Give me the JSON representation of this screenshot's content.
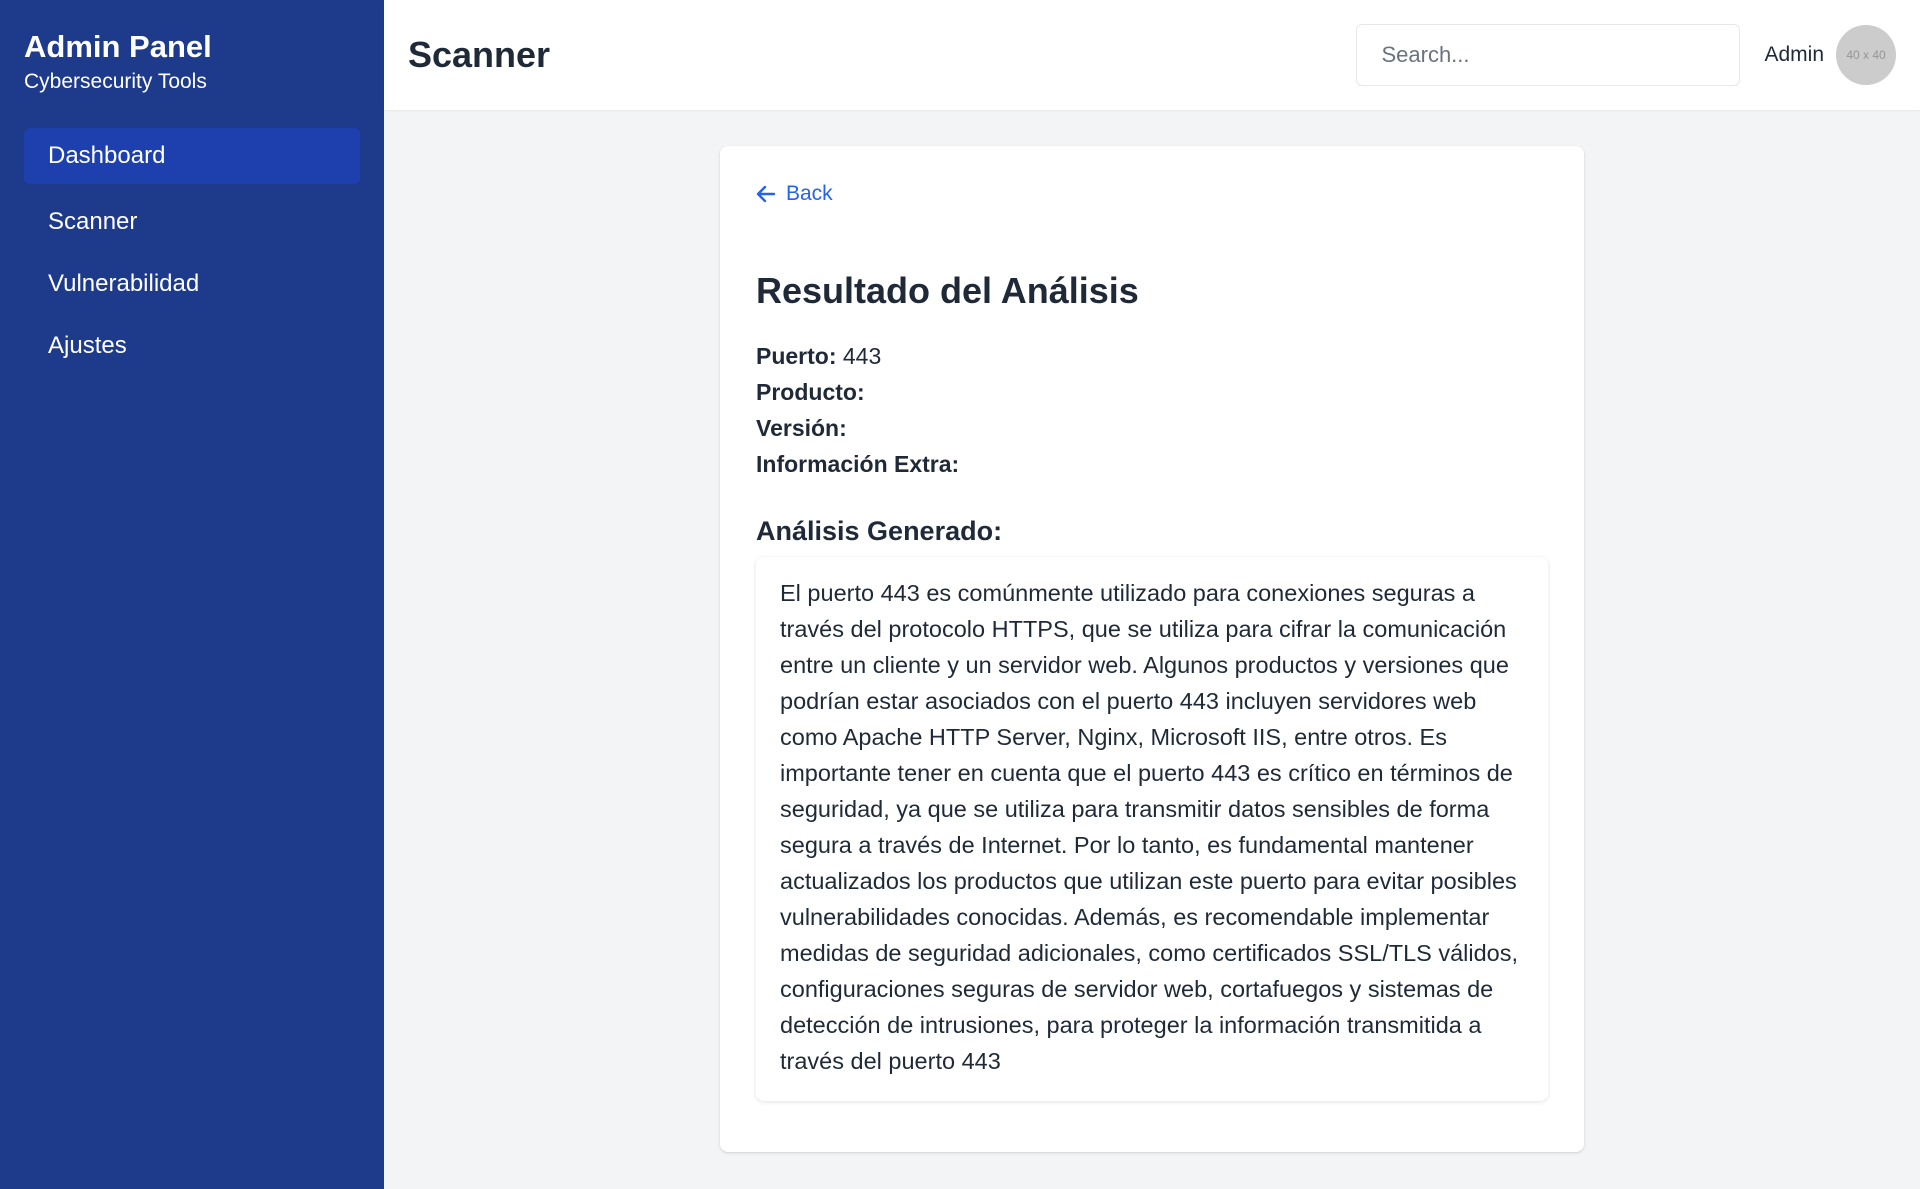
{
  "sidebar": {
    "title": "Admin Panel",
    "subtitle": "Cybersecurity Tools",
    "items": [
      {
        "label": "Dashboard",
        "active": true
      },
      {
        "label": "Scanner",
        "active": false
      },
      {
        "label": "Vulnerabilidad",
        "active": false
      },
      {
        "label": "Ajustes",
        "active": false
      }
    ]
  },
  "header": {
    "title": "Scanner",
    "search_placeholder": "Search...",
    "user_name": "Admin",
    "avatar_text": "40 x 40"
  },
  "result": {
    "back_label": "Back",
    "title": "Resultado del Análisis",
    "fields": [
      {
        "label": "Puerto:",
        "value": "443"
      },
      {
        "label": "Producto:",
        "value": ""
      },
      {
        "label": "Versión:",
        "value": ""
      },
      {
        "label": "Información Extra:",
        "value": ""
      }
    ],
    "analysis_title": "Análisis Generado:",
    "analysis_text": "El puerto 443 es comúnmente utilizado para conexiones seguras a través del protocolo HTTPS, que se utiliza para cifrar la comunicación entre un cliente y un servidor web. Algunos productos y versiones que podrían estar asociados con el puerto 443 incluyen servidores web como Apache HTTP Server, Nginx, Microsoft IIS, entre otros. Es importante tener en cuenta que el puerto 443 es crítico en términos de seguridad, ya que se utiliza para transmitir datos sensibles de forma segura a través de Internet. Por lo tanto, es fundamental mantener actualizados los productos que utilizan este puerto para evitar posibles vulnerabilidades conocidas. Además, es recomendable implementar medidas de seguridad adicionales, como certificados SSL/TLS válidos, configuraciones seguras de servidor web, cortafuegos y sistemas de detección de intrusiones, para proteger la información transmitida a través del puerto 443"
  },
  "colors": {
    "sidebar_bg": "#1e3a8a",
    "sidebar_active": "#1e40af",
    "accent": "#2563eb",
    "page_bg": "#f3f4f6"
  }
}
